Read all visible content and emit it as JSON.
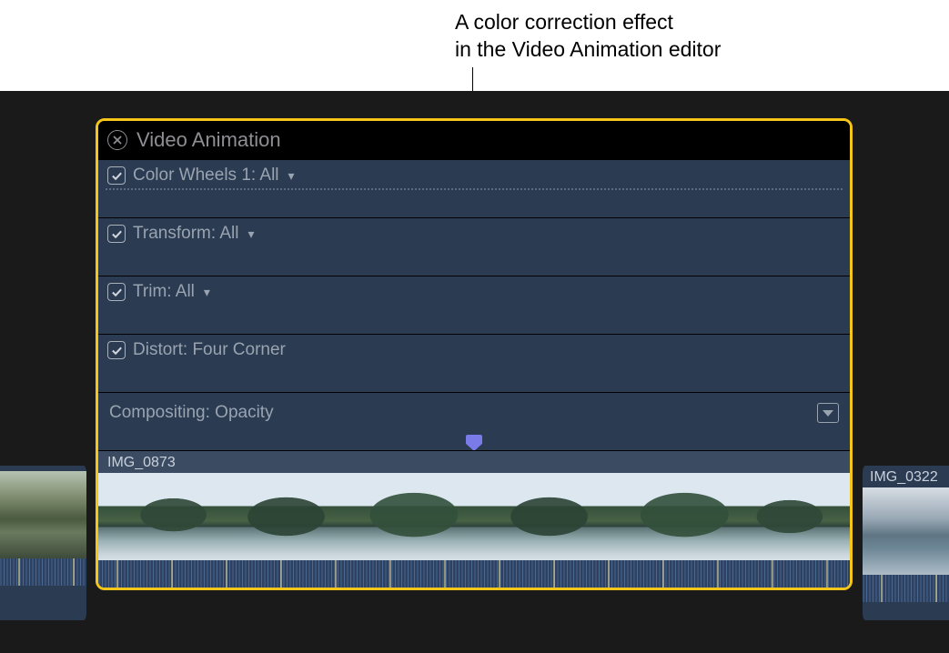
{
  "annotation": {
    "line1": "A color correction effect",
    "line2": "in the Video Animation editor"
  },
  "panel": {
    "title": "Video Animation"
  },
  "tracks": [
    {
      "label": "Color Wheels 1: All",
      "has_chevron": true,
      "has_checkbox": true,
      "checked": true,
      "dotted": true
    },
    {
      "label": "Transform: All",
      "has_chevron": true,
      "has_checkbox": true,
      "checked": true,
      "dotted": false
    },
    {
      "label": "Trim: All",
      "has_chevron": true,
      "has_checkbox": true,
      "checked": true,
      "dotted": false
    },
    {
      "label": "Distort: Four Corner",
      "has_chevron": false,
      "has_checkbox": true,
      "checked": true,
      "dotted": false
    }
  ],
  "compositing": {
    "label": "Compositing: Opacity"
  },
  "clip": {
    "name": "IMG_0873"
  },
  "adjacent_clips": {
    "left_name": "",
    "right_name": "IMG_0322"
  }
}
